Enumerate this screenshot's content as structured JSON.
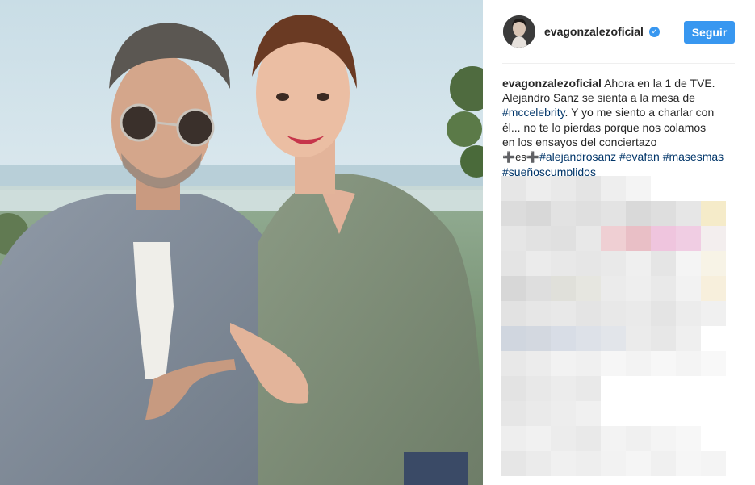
{
  "post": {
    "username": "evagonzalezoficial",
    "verified": true,
    "follow_label": "Seguir",
    "caption": {
      "line1_text": "Ahora en la 1 de TVE.",
      "line2": "Alejandro Sanz se sienta a la mesa de",
      "line3_tag": "#mccelebrity",
      "line3_text": ". Y yo me siento a charlar con",
      "line4": "él... no te lo pierdas porque nos colamos",
      "line5": "en los ensayos del conciertazo",
      "line6_prefix": "➕es➕",
      "tags": [
        "#alejandrosanz",
        "#evafan",
        "#masesmas",
        "#sueñoscumplidos"
      ]
    }
  },
  "colors": {
    "accent": "#3897f0",
    "hashtag": "#003569",
    "text": "#262626"
  },
  "icons": {
    "verified": "verified-check-icon"
  }
}
